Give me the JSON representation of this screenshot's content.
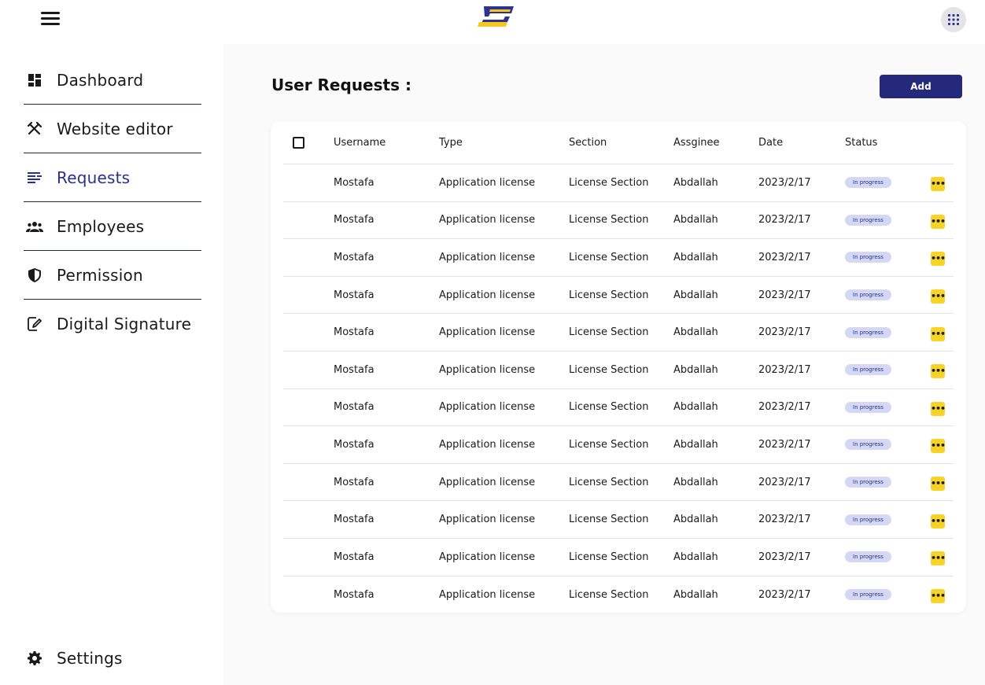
{
  "header": {
    "menu_icon": "hamburger-menu-icon",
    "logo_icon": "brand-logo",
    "apps_icon": "apps-grid-icon",
    "colors": {
      "logo_blue": "#2c3290",
      "logo_yellow": "#f6c81f"
    }
  },
  "sidebar": {
    "items": [
      {
        "label": "Dashboard",
        "icon": "dashboard-icon",
        "active": false
      },
      {
        "label": "Website editor",
        "icon": "tools-icon",
        "active": false
      },
      {
        "label": "Requests",
        "icon": "requests-icon",
        "active": true
      },
      {
        "label": "Employees",
        "icon": "employees-icon",
        "active": false
      },
      {
        "label": "Permission",
        "icon": "shield-icon",
        "active": false
      },
      {
        "label": "Digital Signature",
        "icon": "signature-icon",
        "active": false
      }
    ],
    "settings": {
      "label": "Settings",
      "icon": "gear-icon"
    }
  },
  "main": {
    "title": "User Requests :",
    "add_label": "Add",
    "table": {
      "columns": [
        "Username",
        "Type",
        "Section",
        "Assginee",
        "Date",
        "Status"
      ],
      "rows": [
        {
          "username": "Mostafa",
          "type": "Application license",
          "section": "License Section",
          "assignee": "Abdallah",
          "date": "2023/2/17",
          "status": "In progress"
        },
        {
          "username": "Mostafa",
          "type": "Application license",
          "section": "License Section",
          "assignee": "Abdallah",
          "date": "2023/2/17",
          "status": "In progress"
        },
        {
          "username": "Mostafa",
          "type": "Application license",
          "section": "License Section",
          "assignee": "Abdallah",
          "date": "2023/2/17",
          "status": "In progress"
        },
        {
          "username": "Mostafa",
          "type": "Application license",
          "section": "License Section",
          "assignee": "Abdallah",
          "date": "2023/2/17",
          "status": "In progress"
        },
        {
          "username": "Mostafa",
          "type": "Application license",
          "section": "License Section",
          "assignee": "Abdallah",
          "date": "2023/2/17",
          "status": "In progress"
        },
        {
          "username": "Mostafa",
          "type": "Application license",
          "section": "License Section",
          "assignee": "Abdallah",
          "date": "2023/2/17",
          "status": "In progress"
        },
        {
          "username": "Mostafa",
          "type": "Application license",
          "section": "License Section",
          "assignee": "Abdallah",
          "date": "2023/2/17",
          "status": "In progress"
        },
        {
          "username": "Mostafa",
          "type": "Application license",
          "section": "License Section",
          "assignee": "Abdallah",
          "date": "2023/2/17",
          "status": "In progress"
        },
        {
          "username": "Mostafa",
          "type": "Application license",
          "section": "License Section",
          "assignee": "Abdallah",
          "date": "2023/2/17",
          "status": "In progress"
        },
        {
          "username": "Mostafa",
          "type": "Application license",
          "section": "License Section",
          "assignee": "Abdallah",
          "date": "2023/2/17",
          "status": "In progress"
        },
        {
          "username": "Mostafa",
          "type": "Application license",
          "section": "License Section",
          "assignee": "Abdallah",
          "date": "2023/2/17",
          "status": "In progress"
        },
        {
          "username": "Mostafa",
          "type": "Application license",
          "section": "License Section",
          "assignee": "Abdallah",
          "date": "2023/2/17",
          "status": "In progress"
        }
      ]
    },
    "colors": {
      "accent": "#25297c",
      "badge_bg": "#d4d8f4",
      "action": "#f5d328"
    }
  }
}
